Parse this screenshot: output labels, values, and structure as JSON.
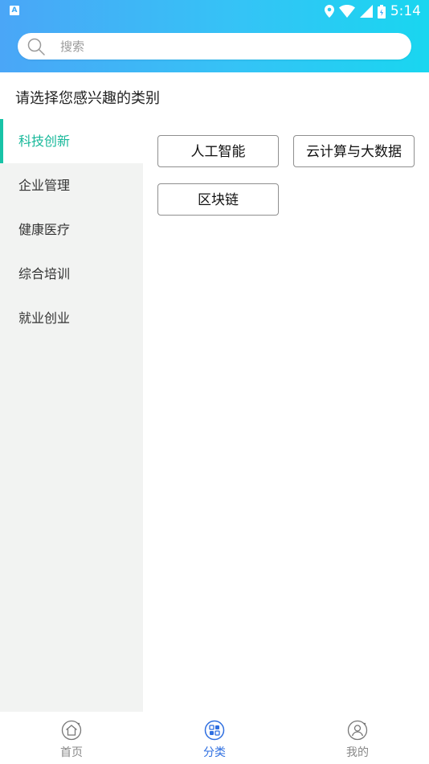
{
  "status_bar": {
    "indicator": "A",
    "time": "5:14",
    "icons": [
      "location-icon",
      "wifi-icon",
      "signal-icon",
      "battery-icon"
    ]
  },
  "search": {
    "placeholder": "搜索"
  },
  "page_title": "请选择您感兴趣的类别",
  "categories": [
    {
      "label": "科技创新",
      "active": true
    },
    {
      "label": "企业管理",
      "active": false
    },
    {
      "label": "健康医疗",
      "active": false
    },
    {
      "label": "综合培训",
      "active": false
    },
    {
      "label": "就业创业",
      "active": false
    }
  ],
  "tags": [
    "人工智能",
    "云计算与大数据",
    "区块链"
  ],
  "tabbar": {
    "items": [
      {
        "label": "首页",
        "icon": "home-icon",
        "active": false
      },
      {
        "label": "分类",
        "icon": "category-icon",
        "active": true
      },
      {
        "label": "我的",
        "icon": "profile-icon",
        "active": false
      }
    ]
  },
  "colors": {
    "header_start": "#4aa6f7",
    "header_end": "#19d6f0",
    "active_category": "#18b89a",
    "active_tab": "#2f6fe0"
  }
}
